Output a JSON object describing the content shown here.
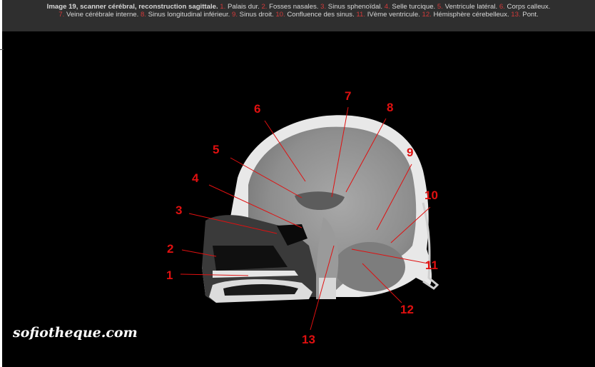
{
  "caption": {
    "title": "Image 19, scanner cérébral, reconstruction sagittale.",
    "items": [
      {
        "num": "1.",
        "text": " Palais dur. "
      },
      {
        "num": "2.",
        "text": " Fosses nasales. "
      },
      {
        "num": "3.",
        "text": " Sinus sphenoïdal. "
      },
      {
        "num": "4.",
        "text": " Selle turcique. "
      },
      {
        "num": "5.",
        "text": " Ventricule latéral. "
      },
      {
        "num": "6.",
        "text": " Corps calleux. "
      },
      {
        "num": "7.",
        "text": " Veine cérébrale interne. "
      },
      {
        "num": "8.",
        "text": " Sinus longitudinal inférieur. "
      },
      {
        "num": "9.",
        "text": " Sinus droit. "
      },
      {
        "num": "10.",
        "text": " Confluence des sinus. "
      },
      {
        "num": "11.",
        "text": " IVème ventricule. "
      },
      {
        "num": "12.",
        "text": " Hémisphère cérebelleux. "
      },
      {
        "num": "13.",
        "text": " Pont."
      }
    ]
  },
  "labels": {
    "l1": "1",
    "l2": "2",
    "l3": "3",
    "l4": "4",
    "l5": "5",
    "l6": "6",
    "l7": "7",
    "l8": "8",
    "l9": "9",
    "l10": "10",
    "l11": "11",
    "l12": "12",
    "l13": "13"
  },
  "watermark": "sofiotheque.com",
  "colors": {
    "label_red": "#e01010",
    "caption_bg": "#2f2f2f",
    "background": "#000000"
  }
}
